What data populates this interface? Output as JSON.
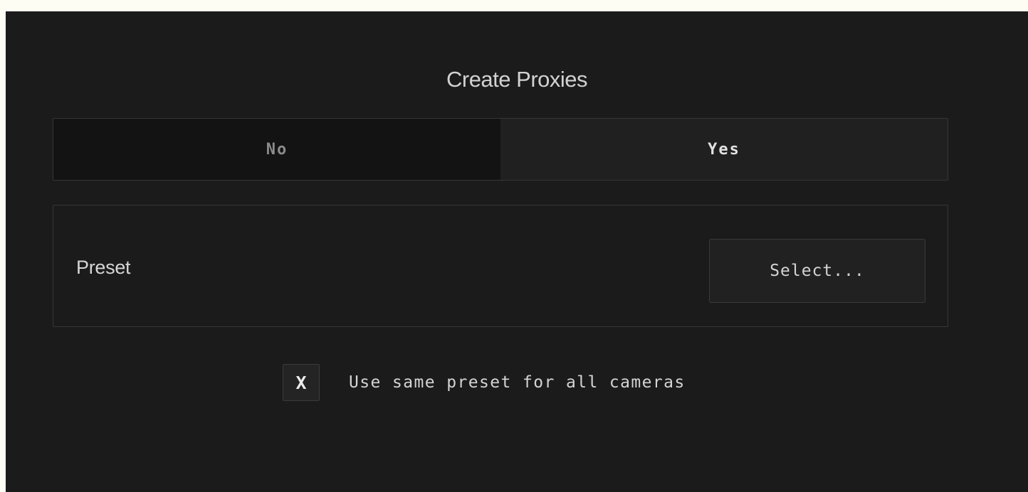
{
  "dialog": {
    "title": "Create Proxies"
  },
  "proxy_toggle": {
    "options": [
      {
        "label": "No",
        "selected": false
      },
      {
        "label": "Yes",
        "selected": true
      }
    ]
  },
  "preset": {
    "label": "Preset",
    "select_label": "Select..."
  },
  "same_preset": {
    "checked": true,
    "check_mark": "X",
    "label": "Use same preset for all cameras"
  },
  "colors": {
    "background": "#1b1b1b",
    "selected_segment": "#202020",
    "unselected_segment": "#131313",
    "border": "#363636"
  }
}
